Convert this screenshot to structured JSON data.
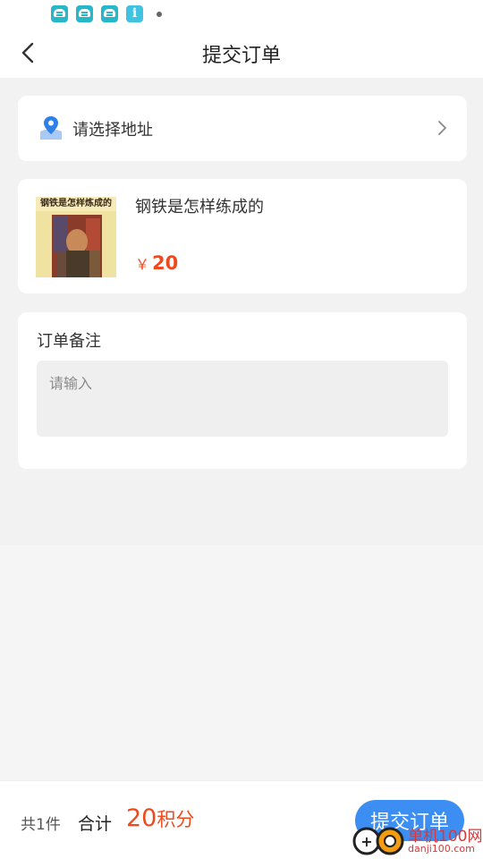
{
  "status_bar": {
    "icons": [
      "robot-app-icon",
      "robot-app-icon",
      "robot-app-icon",
      "info-app-icon",
      "notification-dot"
    ]
  },
  "nav": {
    "back_icon": "chevron-left-icon",
    "title": "提交订单"
  },
  "address": {
    "icon": "location-pin-icon",
    "placeholder_text": "请选择地址",
    "chevron_icon": "chevron-right-icon"
  },
  "product": {
    "cover_title": "钢铁是怎样炼成的",
    "name": "钢铁是怎样练成的",
    "currency_symbol": "￥",
    "price": "20"
  },
  "remark": {
    "label": "订单备注",
    "placeholder": "请输入",
    "value": ""
  },
  "footer": {
    "count_text": "共1件",
    "total_label": "合计",
    "total_number": "20",
    "total_unit": "积分",
    "submit_label": "提交订单"
  },
  "watermark": {
    "text_cn": "单机100网",
    "text_en": "danji100.com"
  },
  "colors": {
    "accent_orange": "#ef4a1e",
    "primary_blue": "#3d8ef2",
    "status_teal": "#26b7c9",
    "background": "#f5f5f5"
  }
}
